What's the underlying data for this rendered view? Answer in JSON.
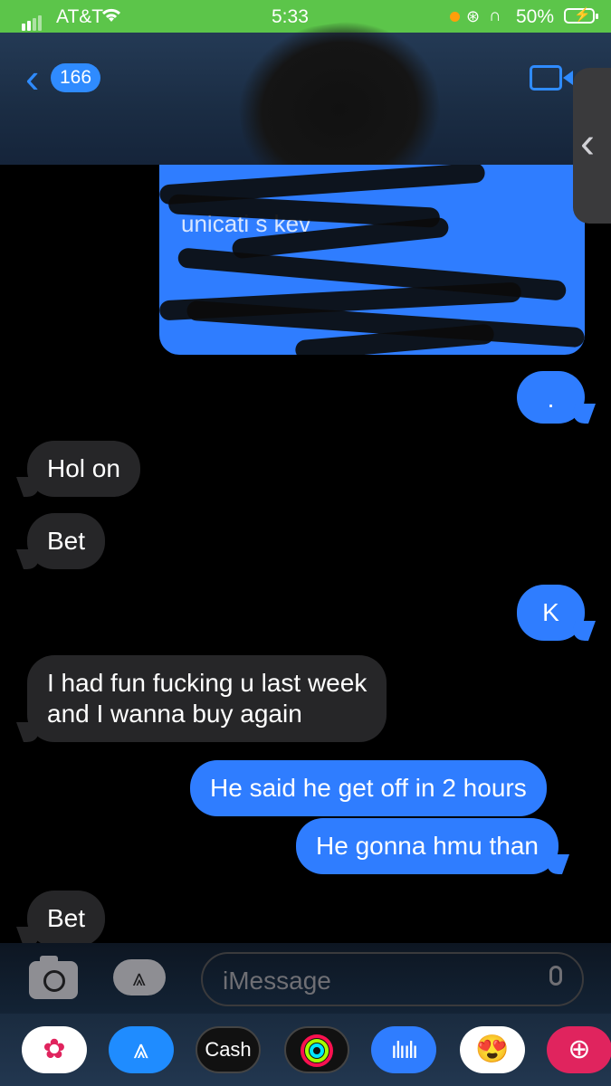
{
  "status_bar": {
    "carrier": "AT&T",
    "time": "5:33",
    "battery": "50%"
  },
  "header": {
    "back_count": "166"
  },
  "messages": [
    {
      "side": "out",
      "text": "."
    },
    {
      "side": "in",
      "text": "Hol on"
    },
    {
      "side": "in",
      "text": "Bet"
    },
    {
      "side": "out",
      "text": "K"
    },
    {
      "side": "in",
      "text": "I had fun fucking u last week\nand I wanna buy again"
    },
    {
      "side": "out",
      "text": "He said he get off in 2 hours"
    },
    {
      "side": "out",
      "text": "He gonna hmu than"
    },
    {
      "side": "in",
      "text": "Bet"
    }
  ],
  "redacted_fragment": "unicati  s kev",
  "input": {
    "placeholder": "iMessage"
  },
  "app_drawer": [
    "Photos",
    "App Store",
    "Cash",
    "Activity",
    "Audio",
    "Memoji",
    "Search"
  ],
  "app_drawer_labels": {
    "cash": "Cash"
  },
  "colors": {
    "outgoing": "#2f7dff",
    "incoming": "#262628",
    "status_bar": "#5cc54a"
  }
}
